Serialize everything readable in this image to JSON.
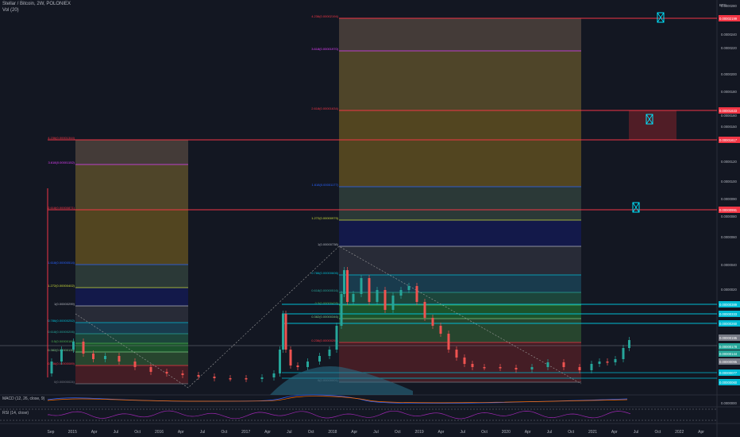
{
  "header": {
    "symbol": "Stellar / Bitcoin, 2W, POLONIEX",
    "volume": "Vol (20)",
    "macd": "MACD (12, 26, close, 9)",
    "rsi": "RSI (14, close)",
    "currency": "BTC"
  },
  "chart_data": {
    "type": "candlestick",
    "x_ticks": [
      "Sep",
      "2015",
      "Apr",
      "Jul",
      "Oct",
      "2016",
      "Apr",
      "Jul",
      "Oct",
      "2017",
      "Apr",
      "Jul",
      "Oct",
      "2018",
      "Apr",
      "Jul",
      "Oct",
      "2019",
      "Apr",
      "Jul",
      "Oct",
      "2020",
      "Apr",
      "Jul",
      "Oct",
      "2021",
      "Apr",
      "Jul",
      "Oct",
      "2022",
      "Apr"
    ],
    "y_ticks": [
      "0.0000280",
      "0.0000240",
      "0.0000220",
      "0.0000200",
      "0.0000180",
      "0.0000160",
      "0.0000150",
      "0.0000140",
      "0.0000120",
      "0.0000100",
      "0.0000090",
      "0.0000080",
      "0.0000060",
      "0.0000040",
      "0.0000020",
      "0.0000000"
    ],
    "price_tags": [
      {
        "text": "0.00002199",
        "color": "#f23645"
      },
      {
        "text": "0.00001633",
        "color": "#f23645"
      },
      {
        "text": "0.00001617",
        "color": "#f23645"
      },
      {
        "text": "0.00000991",
        "color": "#f23645"
      },
      {
        "text": "0.00000389",
        "color": "#00bcd4"
      },
      {
        "text": "0.00000333",
        "color": "#00bcd4"
      },
      {
        "text": "0.00000260",
        "color": "#00bcd4"
      },
      {
        "text": "0.00000195",
        "color": "#787b86"
      },
      {
        "text": "0.00000178",
        "color": "#26a69a"
      },
      {
        "text": "0.00000144",
        "color": "#26a69a"
      },
      {
        "text": "0.00000095",
        "color": "#787b86"
      },
      {
        "text": "0.00000077",
        "color": "#00bcd4"
      },
      {
        "text": "0.00000060",
        "color": "#00bcd4"
      }
    ],
    "fib_left": [
      {
        "label": "4.236(0.00001344)",
        "color": "#f23645"
      },
      {
        "label": "3.618(0.00001152)",
        "color": "#e040fb"
      },
      {
        "label": "2.618(0.00000871)",
        "color": "#f23645"
      },
      {
        "label": "1.618(0.00000514)",
        "color": "#2962ff"
      },
      {
        "label": "1.272(0.00000402)",
        "color": "#cddc39"
      },
      {
        "label": "1(0.00000299)",
        "color": "#b2b5be"
      },
      {
        "label": "0.786(0.00000252)",
        "color": "#00bcd4"
      },
      {
        "label": "0.618(0.00000206)",
        "color": "#26a69a"
      },
      {
        "label": "0.5(0.00000169)",
        "color": "#4caf50"
      },
      {
        "label": "0.382(0.00000135)",
        "color": "#81c784"
      },
      {
        "label": "0.236(0.00000089)",
        "color": "#f23645"
      },
      {
        "label": "0(0.00000024)",
        "color": "#787b86"
      }
    ],
    "fib_right": [
      {
        "label": "4.236(0.00002194)",
        "color": "#f23645"
      },
      {
        "label": "3.618(0.00001970)",
        "color": "#e040fb"
      },
      {
        "label": "2.618(0.00001634)",
        "color": "#f23645"
      },
      {
        "label": "1.618(0.00001177)",
        "color": "#2962ff"
      },
      {
        "label": "1.272(0.00000979)",
        "color": "#cddc39"
      },
      {
        "label": "1(0.00000738)",
        "color": "#b2b5be"
      },
      {
        "label": "0.786(0.00000606)",
        "color": "#00bcd4"
      },
      {
        "label": "0.618(0.00000516)",
        "color": "#26a69a"
      },
      {
        "label": "0.5(0.00000428)",
        "color": "#4caf50"
      },
      {
        "label": "0.382(0.00000346)",
        "color": "#81c784"
      },
      {
        "label": "0.236(0.00000256)",
        "color": "#f23645"
      },
      {
        "label": "0(0.00000001)",
        "color": "#787b86"
      }
    ]
  }
}
